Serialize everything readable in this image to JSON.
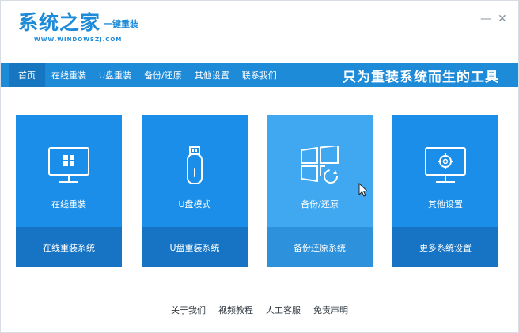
{
  "app": {
    "logo_title": "系统之家",
    "logo_tag": "一键重装",
    "logo_url": "WWW.WINDOWSZJ.COM"
  },
  "window_controls": {
    "minimize": "—",
    "close": "✕"
  },
  "nav": {
    "items": [
      "首页",
      "在线重装",
      "U盘重装",
      "备份/还原",
      "其他设置",
      "联系我们"
    ],
    "active_index": 0,
    "slogan": "只为重装系统而生的工具"
  },
  "cards": [
    {
      "icon": "monitor-windows-icon",
      "title": "在线重装",
      "action": "在线重装系统"
    },
    {
      "icon": "usb-drive-icon",
      "title": "U盘模式",
      "action": "U盘重装系统"
    },
    {
      "icon": "windows-restore-icon",
      "title": "备份/还原",
      "action": "备份还原系统"
    },
    {
      "icon": "monitor-gear-icon",
      "title": "其他设置",
      "action": "更多系统设置"
    }
  ],
  "hovered_card_index": 2,
  "footer": {
    "links": [
      "关于我们",
      "视频教程",
      "人工客服",
      "免责声明"
    ]
  },
  "colors": {
    "brand": "#1e8bd9",
    "card": "#1a8ee8",
    "card_hover": "#40a7f1",
    "card_bottom": "#1774c4"
  }
}
